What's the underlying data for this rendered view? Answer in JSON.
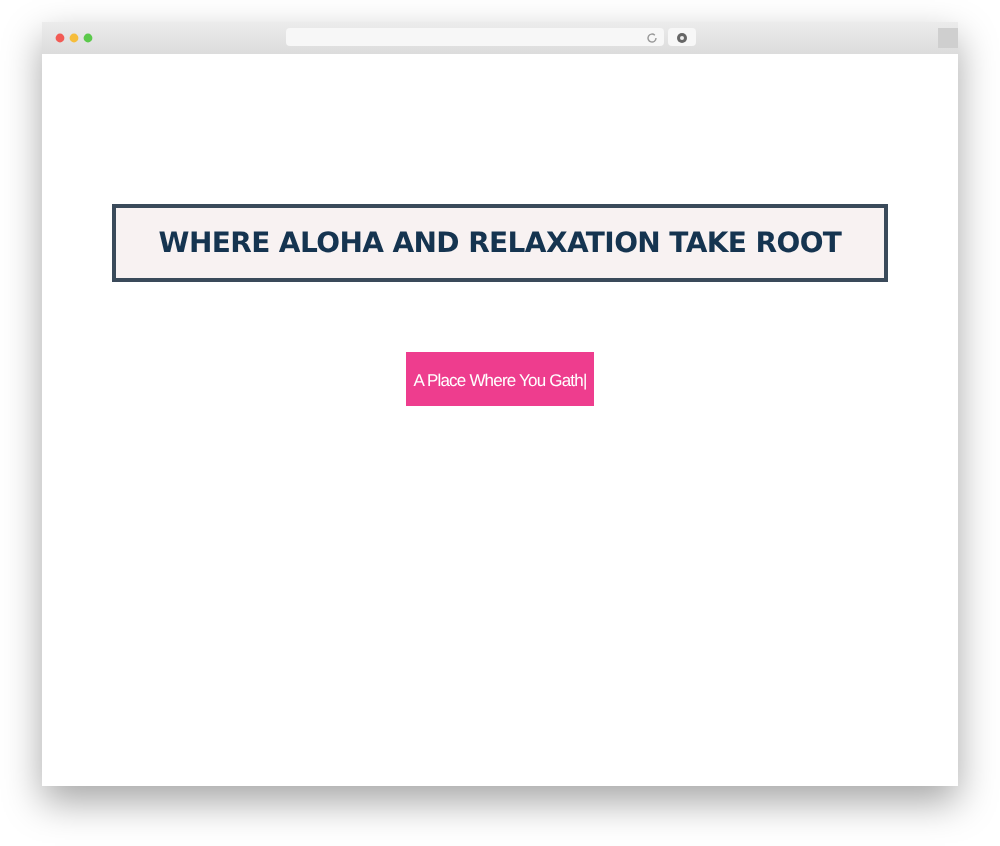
{
  "banner": {
    "title": "WHERE ALOHA AND RELAXATION TAKE ROOT"
  },
  "button": {
    "label": "A Place Where You Gath|"
  }
}
